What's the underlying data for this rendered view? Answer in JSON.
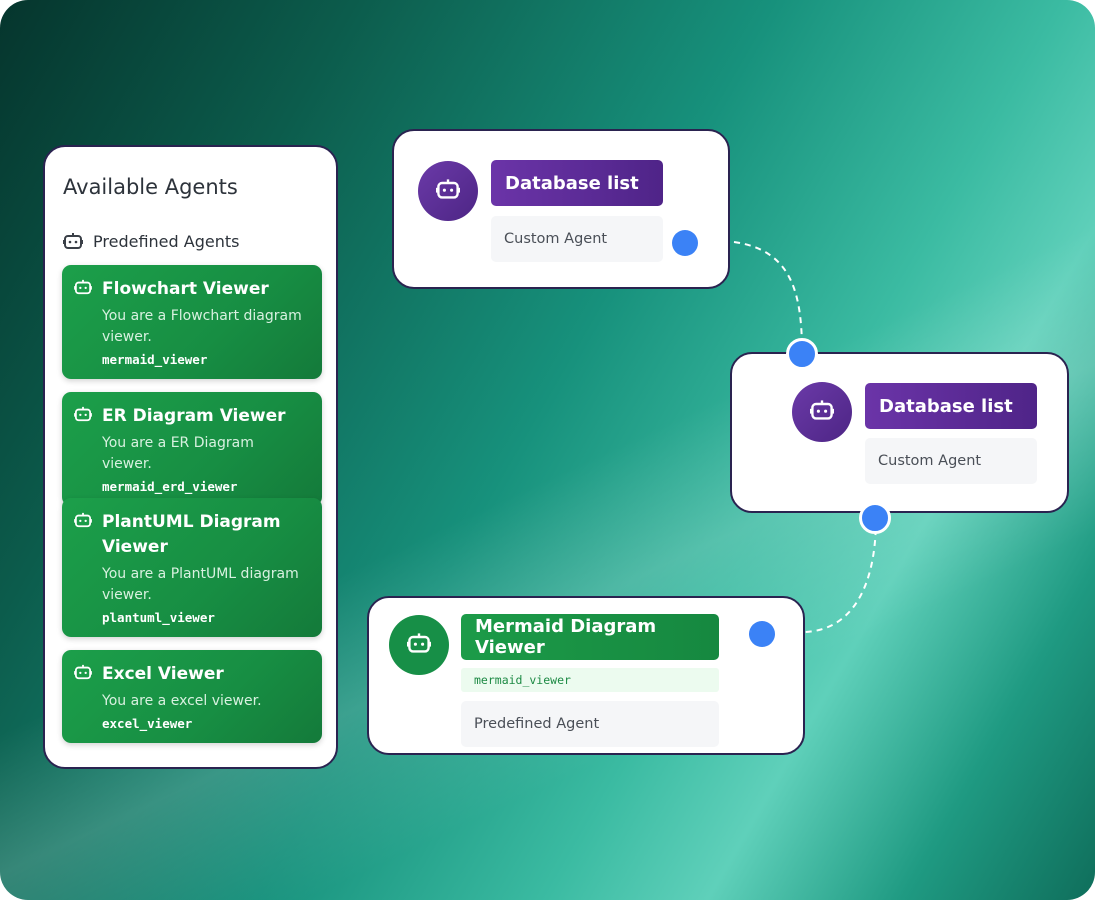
{
  "panel": {
    "title": "Available Agents",
    "section_label": "Predefined Agents",
    "agents": [
      {
        "name": "Flowchart Viewer",
        "description": "You are a Flowchart diagram viewer.",
        "code": "mermaid_viewer"
      },
      {
        "name": "ER Diagram Viewer",
        "description": "You are a ER Diagram viewer.",
        "code": "mermaid_erd_viewer"
      },
      {
        "name": "PlantUML Diagram Viewer",
        "description": "You are a PlantUML diagram viewer.",
        "code": "plantuml_viewer"
      },
      {
        "name": "Excel Viewer",
        "description": "You are a excel viewer.",
        "code": "excel_viewer"
      }
    ]
  },
  "nodes": [
    {
      "title": "Database list",
      "subtitle": "Custom Agent",
      "color": "purple"
    },
    {
      "title": "Database list",
      "subtitle": "Custom Agent",
      "color": "purple"
    },
    {
      "title": "Mermaid Diagram Viewer",
      "code": "mermaid_viewer",
      "subtitle": "Predefined Agent",
      "color": "green"
    }
  ],
  "colors": {
    "green": "#178f47",
    "purple": "#5b2c96",
    "handle": "#3b82f6",
    "border": "#2a2350"
  },
  "icons": {
    "agent": "robot-icon"
  }
}
